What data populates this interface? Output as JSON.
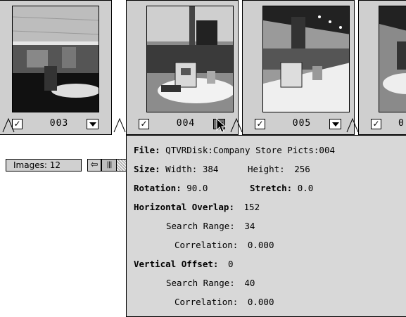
{
  "filmstrip": {
    "frames": [
      {
        "number": "003",
        "checked": "✓"
      },
      {
        "number": "004",
        "checked": "✓"
      },
      {
        "number": "005",
        "checked": "✓"
      },
      {
        "number": "0",
        "checked": "✓"
      }
    ]
  },
  "status": {
    "images_label": "Images: 12",
    "scroll_left_glyph": "⇦",
    "scroll_thumb_glyph": "|||"
  },
  "info_panel": {
    "file_label": "File:",
    "file_value": "QTVRDisk:Company Store Picts:004",
    "size_label": "Size:",
    "width_label": "Width:",
    "width_value": "384",
    "height_label": "Height:",
    "height_value": "256",
    "rotation_label": "Rotation:",
    "rotation_value": "90.0",
    "stretch_label": "Stretch:",
    "stretch_value": "0.0",
    "h_overlap_label": "Horizontal Overlap:",
    "h_overlap_value": "152",
    "h_search_label": "Search Range:",
    "h_search_value": "34",
    "h_corr_label": "Correlation:",
    "h_corr_value": "0.000",
    "v_offset_label": "Vertical Offset:",
    "v_offset_value": "0",
    "v_search_label": "Search Range:",
    "v_search_value": "40",
    "v_corr_label": "Correlation:",
    "v_corr_value": "0.000"
  }
}
